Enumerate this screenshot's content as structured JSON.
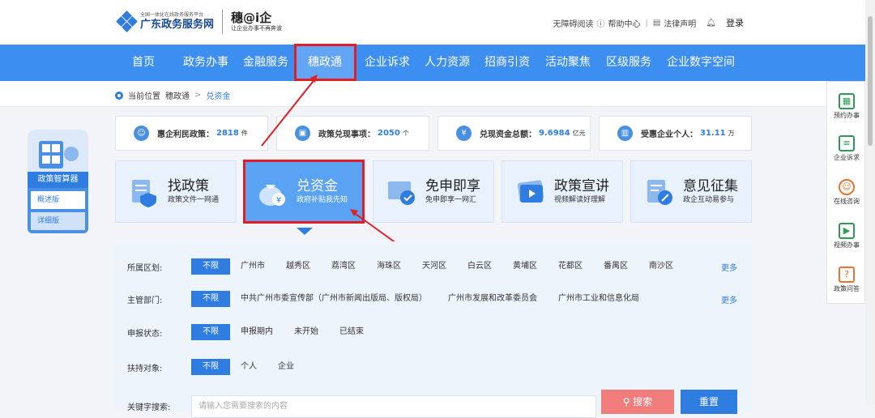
{
  "header": {
    "logo_small": "全国一体化在线政务服务平台",
    "logo_big": "广东政务服务网",
    "brand_big": "穗@i企",
    "brand_small": "让企业办事不再奔波",
    "links": {
      "accessibility": "无障碍阅读",
      "help": "帮助中心",
      "legal": "法律声明",
      "login": "登录"
    }
  },
  "nav": {
    "items": [
      "首页",
      "政务办事",
      "金融服务",
      "穗政通",
      "企业诉求",
      "人力资源",
      "招商引资",
      "活动聚焦",
      "区级服务",
      "企业数字空间"
    ],
    "active": "穗政通"
  },
  "breadcrumb": {
    "prefix": "当前位置",
    "level1": "穗政通",
    "separator": ">",
    "current": "兑资金"
  },
  "stats": [
    {
      "label": "惠企利民政策：",
      "value": "2818",
      "unit": "件"
    },
    {
      "label": "政策兑现事项：",
      "value": "2050",
      "unit": "个"
    },
    {
      "label": "兑现资金总额：",
      "value": "9.6984",
      "unit": "亿元"
    },
    {
      "label": "受惠企业个人：",
      "value": "31.11",
      "unit": "万"
    }
  ],
  "cards": [
    {
      "title": "找政策",
      "sub": "政策文件一网通"
    },
    {
      "title": "兑资金",
      "sub": "政府补贴我先知"
    },
    {
      "title": "免申即享",
      "sub": "免申即享一网汇"
    },
    {
      "title": "政策宣讲",
      "sub": "视频解读好理解"
    },
    {
      "title": "意见征集",
      "sub": "政企互动易参与"
    }
  ],
  "filters": {
    "region": {
      "label": "所属区划:",
      "options": [
        "不限",
        "广州市",
        "越秀区",
        "荔湾区",
        "海珠区",
        "天河区",
        "白云区",
        "黄埔区",
        "花都区",
        "番禺区",
        "南沙区"
      ],
      "more": "更多"
    },
    "dept": {
      "label": "主管部门:",
      "options": [
        "不限",
        "中共广州市委宣传部（广州市新闻出版局、版权局）",
        "广州市发展和改革委员会",
        "广州市工业和信息化局"
      ],
      "more": "更多"
    },
    "status": {
      "label": "申报状态:",
      "options": [
        "不限",
        "申报期内",
        "未开始",
        "已结束"
      ]
    },
    "target": {
      "label": "扶持对象:",
      "options": [
        "不限",
        "个人",
        "企业"
      ]
    },
    "keyword": {
      "label": "关键字搜索:",
      "placeholder": "请输入您需要搜索的内容",
      "search": "搜索",
      "reset": "重置"
    }
  },
  "left_panel": {
    "title": "政策智算器",
    "btn1": "概述版",
    "btn2": "详细版"
  },
  "right_panel": [
    {
      "label": "预约办事",
      "icon": "calendar-icon"
    },
    {
      "label": "企业诉求",
      "icon": "document-icon"
    },
    {
      "label": "在线咨询",
      "icon": "headset-icon"
    },
    {
      "label": "视频办事",
      "icon": "video-icon"
    },
    {
      "label": "政策问答",
      "icon": "qa-icon"
    }
  ],
  "colors": {
    "nav_bg": "#3c8ef0",
    "accent": "#2f7de1",
    "highlight": "#e01e24"
  }
}
